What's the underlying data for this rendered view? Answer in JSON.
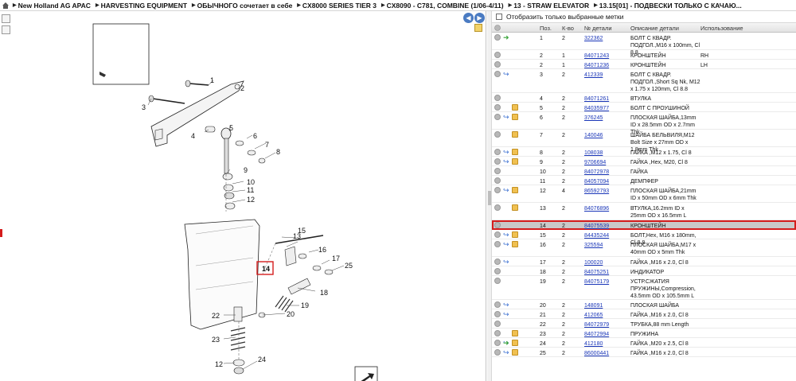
{
  "breadcrumbs": [
    "New Holland AG APAC",
    "HARVESTING EQUIPMENT",
    "ОБЫЧНОГО сочетает в себе",
    "CX8000 SERIES TIER 3",
    "CX8090 - C781, COMBINE (1/06-4/11)",
    "13 - STRAW ELEVATOR",
    "13.15[01] - ПОДВЕСКИ ТОЛЬКО С КАЧАЮ..."
  ],
  "filter": {
    "label": "Отобразить только выбранные метки"
  },
  "table": {
    "headers": {
      "pos": "Поз.",
      "qty": "К-во",
      "pn": "№ детали",
      "desc": "Описание детали",
      "use": "Использование"
    },
    "rows": [
      {
        "pos": "1",
        "qty": "2",
        "pn": "322362",
        "desc": "БОЛТ С КВАДР. ПОДГОЛ.,M16 x 100mm, Cl 8.8",
        "use": "",
        "blue": false,
        "green": true,
        "box": false
      },
      {
        "pos": "2",
        "qty": "1",
        "pn": "84071243",
        "desc": "КРОНШТЕЙН",
        "use": "RH",
        "blue": false,
        "green": false,
        "box": false
      },
      {
        "pos": "2",
        "qty": "1",
        "pn": "84071236",
        "desc": "КРОНШТЕЙН",
        "use": "LH",
        "blue": false,
        "green": false,
        "box": false
      },
      {
        "pos": "3",
        "qty": "2",
        "pn": "412339",
        "desc": "БОЛТ С КВАДР. ПОДГОЛ.,Short Sq Nk, M12 x 1.75 x 120mm, Cl 8.8",
        "use": "",
        "blue": true,
        "green": false,
        "box": false
      },
      {
        "pos": "4",
        "qty": "2",
        "pn": "84071261",
        "desc": "ВТУЛКА",
        "use": "",
        "blue": false,
        "green": false,
        "box": false
      },
      {
        "pos": "5",
        "qty": "2",
        "pn": "84035977",
        "desc": "БОЛТ С ПРОУШИНОЙ",
        "use": "",
        "blue": false,
        "green": false,
        "box": true
      },
      {
        "pos": "6",
        "qty": "2",
        "pn": "376245",
        "desc": "ПЛОСКАЯ ШАЙБА,13mm ID x 28.5mm OD x 2.7mm Thk",
        "use": "",
        "blue": true,
        "green": false,
        "box": true
      },
      {
        "pos": "7",
        "qty": "2",
        "pn": "140046",
        "desc": "ШАЙБА БЕЛЬВИЛЯ,M12 Bolt Size x 27mm OD x 1.8mm Thk",
        "use": "",
        "blue": false,
        "green": false,
        "box": true
      },
      {
        "pos": "8",
        "qty": "2",
        "pn": "108038",
        "desc": "ГАЙКА ,M12 x 1.75, Cl 8",
        "use": "",
        "blue": true,
        "green": false,
        "box": true
      },
      {
        "pos": "9",
        "qty": "2",
        "pn": "9706694",
        "desc": "ГАЙКА ,Hex, M20, Cl 8",
        "use": "",
        "blue": true,
        "green": false,
        "box": true
      },
      {
        "pos": "10",
        "qty": "2",
        "pn": "84072978",
        "desc": "ГАЙКА",
        "use": "",
        "blue": false,
        "green": false,
        "box": false
      },
      {
        "pos": "11",
        "qty": "2",
        "pn": "84057094",
        "desc": "ДЕМПФЕР",
        "use": "",
        "blue": false,
        "green": false,
        "box": false
      },
      {
        "pos": "12",
        "qty": "4",
        "pn": "86592793",
        "desc": "ПЛОСКАЯ ШАЙБА,21mm ID x 50mm OD x 6mm Thk",
        "use": "",
        "blue": true,
        "green": false,
        "box": true
      },
      {
        "pos": "13",
        "qty": "2",
        "pn": "84076896",
        "desc": "ВТУЛКА,16.2mm ID x 25mm OD x 16.5mm L",
        "use": "",
        "blue": false,
        "green": false,
        "box": true
      },
      {
        "pos": "14",
        "qty": "2",
        "pn": "84075539",
        "desc": "КРОНШТЕЙН",
        "use": "",
        "blue": false,
        "green": false,
        "box": false,
        "selected": true
      },
      {
        "pos": "15",
        "qty": "2",
        "pn": "84435244",
        "desc": "БОЛТ,Hex, M16 x 180mm, Cl 8.8",
        "use": "",
        "blue": true,
        "green": false,
        "box": true
      },
      {
        "pos": "16",
        "qty": "2",
        "pn": "325594",
        "desc": "ПЛОСКАЯ ШАЙБА,M17 x 40mm OD x 5mm Thk",
        "use": "",
        "blue": true,
        "green": false,
        "box": true
      },
      {
        "pos": "17",
        "qty": "2",
        "pn": "100020",
        "desc": "ГАЙКА ,M16 x 2.0, Cl 8",
        "use": "",
        "blue": true,
        "green": false,
        "box": false
      },
      {
        "pos": "18",
        "qty": "2",
        "pn": "84075251",
        "desc": "ИНДИКАТОР",
        "use": "",
        "blue": false,
        "green": false,
        "box": false
      },
      {
        "pos": "19",
        "qty": "2",
        "pn": "84075179",
        "desc": "УСТР.СЖАТИЯ ПРУЖИНЫ,Compression, 43.5mm OD x 105.5mm L",
        "use": "",
        "blue": false,
        "green": false,
        "box": false
      },
      {
        "pos": "20",
        "qty": "2",
        "pn": "148091",
        "desc": "ПЛОСКАЯ ШАЙБА",
        "use": "",
        "blue": true,
        "green": false,
        "box": false
      },
      {
        "pos": "21",
        "qty": "2",
        "pn": "412065",
        "desc": "ГАЙКА ,M16 x 2.0, Cl 8",
        "use": "",
        "blue": true,
        "green": false,
        "box": false
      },
      {
        "pos": "22",
        "qty": "2",
        "pn": "84072979",
        "desc": "ТРУБКА,88 mm Length",
        "use": "",
        "blue": false,
        "green": false,
        "box": false
      },
      {
        "pos": "23",
        "qty": "2",
        "pn": "84072994",
        "desc": "ПРУЖИНА",
        "use": "",
        "blue": false,
        "green": false,
        "box": true
      },
      {
        "pos": "24",
        "qty": "2",
        "pn": "412180",
        "desc": "ГАЙКА ,M20 x 2.5, Cl 8",
        "use": "",
        "blue": true,
        "green": true,
        "box": true
      },
      {
        "pos": "25",
        "qty": "2",
        "pn": "86000441",
        "desc": "ГАЙКА ,M16 x 2.0, Cl 8",
        "use": "",
        "blue": true,
        "green": false,
        "box": true
      }
    ]
  },
  "diagram": {
    "callouts": [
      "1",
      "2",
      "3",
      "4",
      "5",
      "6",
      "7",
      "8",
      "9",
      "10",
      "11",
      "12",
      "13",
      "14",
      "15",
      "16",
      "17",
      "18",
      "19",
      "20",
      "22",
      "23",
      "12",
      "24",
      "25"
    ],
    "highlighted": "14"
  }
}
